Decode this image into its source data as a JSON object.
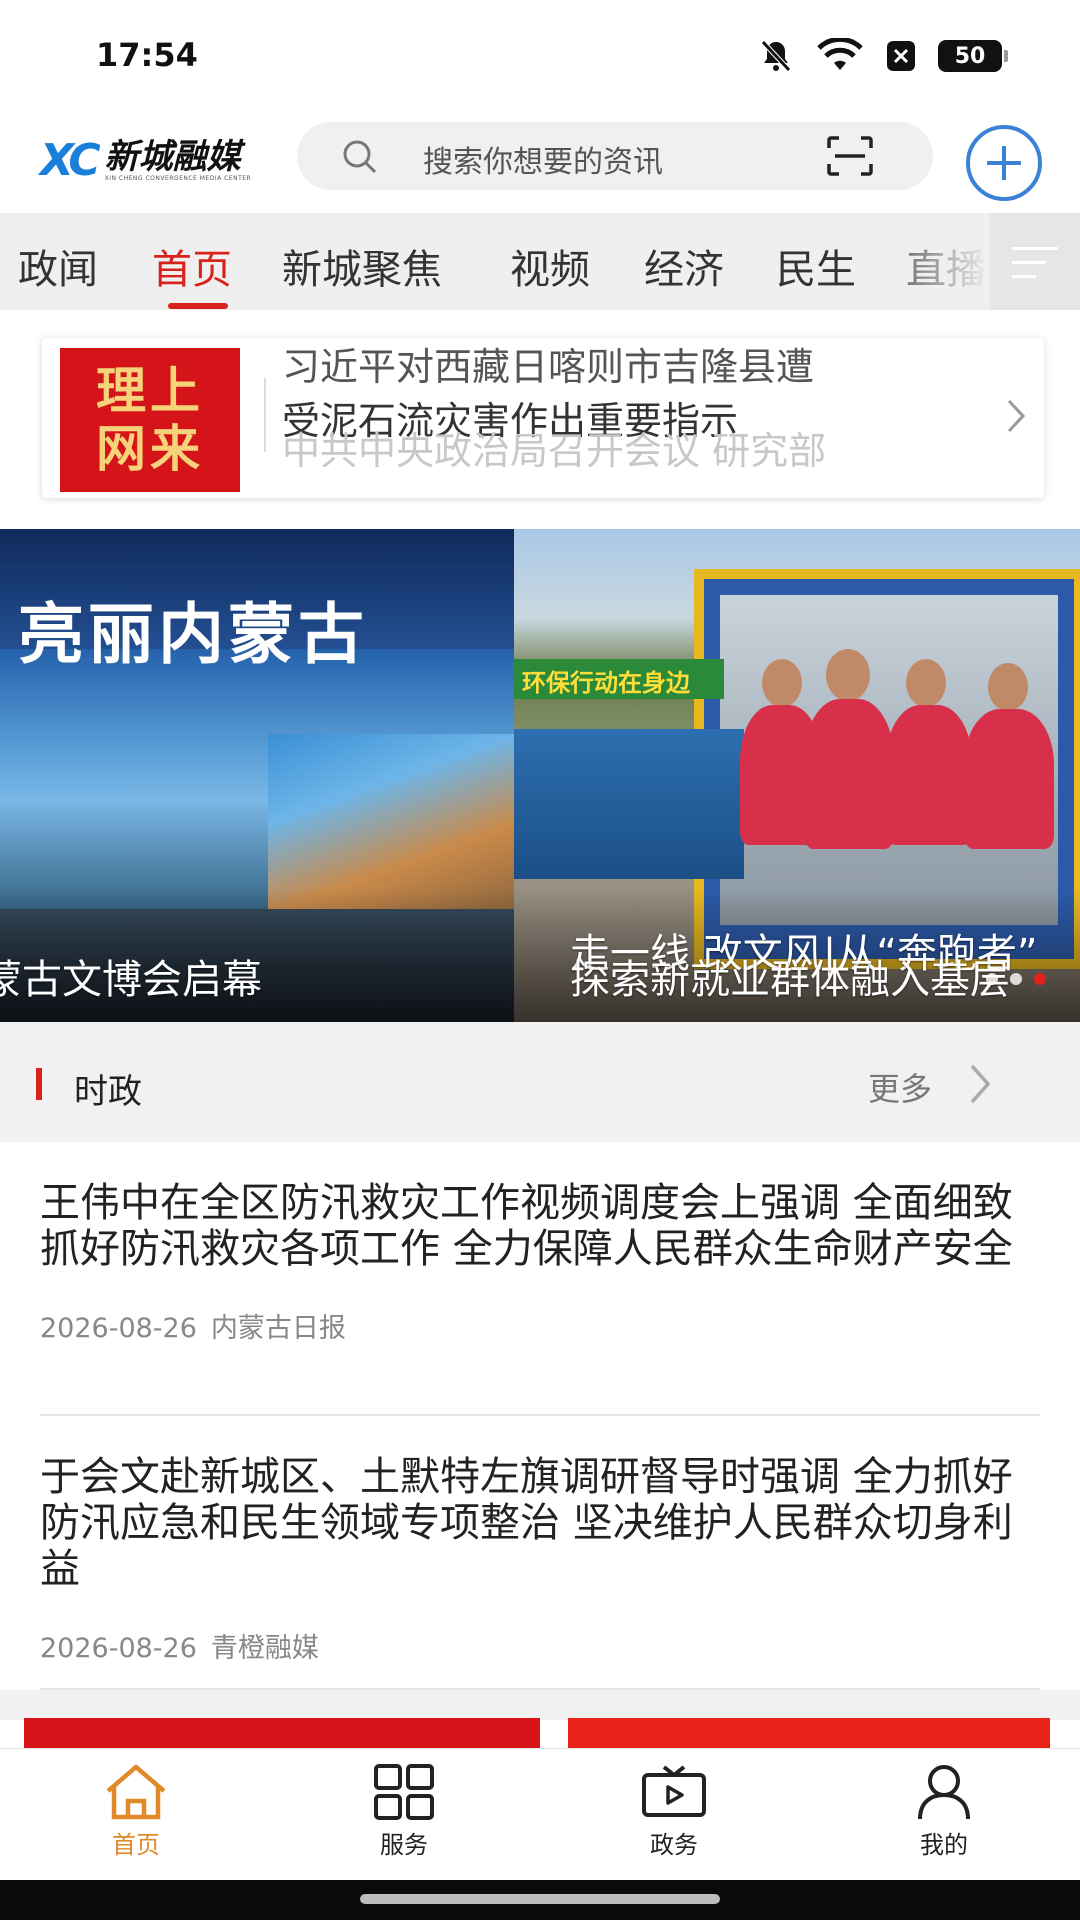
{
  "status_bar": {
    "time": "17:54",
    "battery": "50",
    "icons": [
      "mute-icon",
      "wifi-icon",
      "no-sim-icon",
      "battery-icon"
    ]
  },
  "header": {
    "logo_mark": "XC",
    "logo_text": "新城融媒",
    "logo_sub": "XIN CHENG CONVERGENCE MEDIA CENTER",
    "search_placeholder": "搜索你想要的资讯",
    "icons": [
      "search-icon",
      "scan-icon",
      "plus-icon"
    ]
  },
  "tabs": {
    "items": [
      "政闻",
      "首页",
      "新城聚焦",
      "视频",
      "经济",
      "民生",
      "直播"
    ],
    "active": "首页",
    "accent_color": "#d9221c"
  },
  "theory_card": {
    "badge_line1": "理上",
    "badge_line2": "网来",
    "line1": "习近平对西藏日喀则市吉隆县遭",
    "line2": "受泥石流灾害作出重要指示",
    "line3": "中共中央政治局召开会议 研究部"
  },
  "banner": {
    "left_art_title": "亮丽内蒙古",
    "left_caption": "蒙古文博会启幕",
    "right_sign": "环保行动在身边",
    "right_caption_1": "走一线 改文风|从“奔跑者”",
    "right_caption_2": "探索新就业群体融入基层",
    "active_dot": 3,
    "dot_count": 3
  },
  "section": {
    "title": "时政",
    "more": "更多"
  },
  "news": [
    {
      "title": "王伟中在全区防汛救灾工作视频调度会上强调 全面细致抓好防汛救灾各项工作 全力保障人民群众生命财产安全",
      "date": "2026-08-26",
      "source": "内蒙古日报"
    },
    {
      "title": "于会文赴新城区、土默特左旗调研督导时强调 全力抓好防汛应急和民生领域专项整治 坚决维护人民群众切身利益",
      "date": "2026-08-26",
      "source": "青橙融媒"
    }
  ],
  "bottom_nav": {
    "items": [
      {
        "label": "首页",
        "icon": "home-icon"
      },
      {
        "label": "服务",
        "icon": "grid-icon"
      },
      {
        "label": "政务",
        "icon": "tv-icon"
      },
      {
        "label": "我的",
        "icon": "user-icon"
      }
    ],
    "active": "首页",
    "active_color": "#e08a2a"
  }
}
